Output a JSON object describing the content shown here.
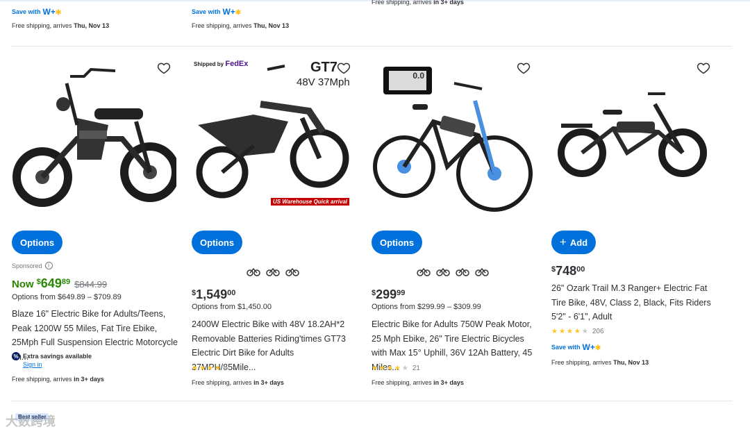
{
  "top_strip": {
    "cards": [
      {
        "save_with": "Save with",
        "wplus": "W+",
        "shipping_prefix": "Free shipping, arrives",
        "shipping_date": "Thu, Nov 13"
      },
      {
        "save_with": "Save with",
        "wplus": "W+",
        "shipping_prefix": "Free shipping, arrives",
        "shipping_date": "Thu, Nov 13"
      },
      {
        "shipping_prefix": "Free shipping, arrives",
        "shipping_date": "in 3+ days"
      }
    ]
  },
  "products": [
    {
      "button": "Options",
      "sponsored": "Sponsored",
      "now_label": "Now",
      "currency": "$",
      "price_main": "649",
      "price_cents": "89",
      "was_price": "$844.99",
      "options_from": "Options from $649.89 – $709.89",
      "title": "Blaze 16\" Electric Bike for Adults/Teens, Peak 1200W 55 Miles, Fat Tire Ebike, 25Mph Full Suspension Electric Motorcycle on...",
      "extra_savings": "Extra savings available",
      "sign_in": "Sign in",
      "shipping_prefix": "Free shipping, arrives",
      "shipping_date": "in 3+ days"
    },
    {
      "button": "Options",
      "image_text_shipped": "Shipped by",
      "image_text_fedex": "FedEx",
      "image_text_gt": "GT7",
      "image_text_spec": "48V 37Mph",
      "image_text_warehouse": "US Warehouse  Quick arrival",
      "currency": "$",
      "price_main": "1,549",
      "price_cents": "00",
      "options_from": "Options from $1,450.00",
      "title": "2400W Electric Bike with 48V 18.2AH*2 Removable Batteries Riding'times GT73 Electric Dirt Bike for Adults 37MPH/85Mile...",
      "rating": 3.5,
      "reviews": "4",
      "shipping_prefix": "Free shipping, arrives",
      "shipping_date": "in 3+ days"
    },
    {
      "button": "Options",
      "image_text_display": "0.0",
      "currency": "$",
      "price_main": "299",
      "price_cents": "99",
      "options_from": "Options from $299.99 – $309.99",
      "title": "Electric Bike for Adults 750W Peak Motor, 25 Mph Ebike, 26\" Tire Electric Bicycles with Max 15° Uphill, 36V 12Ah Battery, 45 Miles...",
      "rating": 4,
      "reviews": "21",
      "shipping_prefix": "Free shipping, arrives",
      "shipping_date": "in 3+ days"
    },
    {
      "button": "Add",
      "currency": "$",
      "price_main": "748",
      "price_cents": "00",
      "title": "26\" Ozark Trail M.3 Ranger+ Electric Fat Tire Bike, 48V, Class 2, Black, Fits Riders 5'2\" - 6'1\", Adult",
      "rating": 4,
      "reviews": "206",
      "save_with": "Save with",
      "wplus": "W+",
      "shipping_prefix": "Free shipping, arrives",
      "shipping_date": "Thu, Nov 13"
    }
  ],
  "bottom": {
    "best_seller": "Best seller",
    "watermark": "大数跨境"
  },
  "colors": {
    "accent": "#0071dc",
    "now_price": "#2a8703",
    "star": "#ffc220"
  }
}
